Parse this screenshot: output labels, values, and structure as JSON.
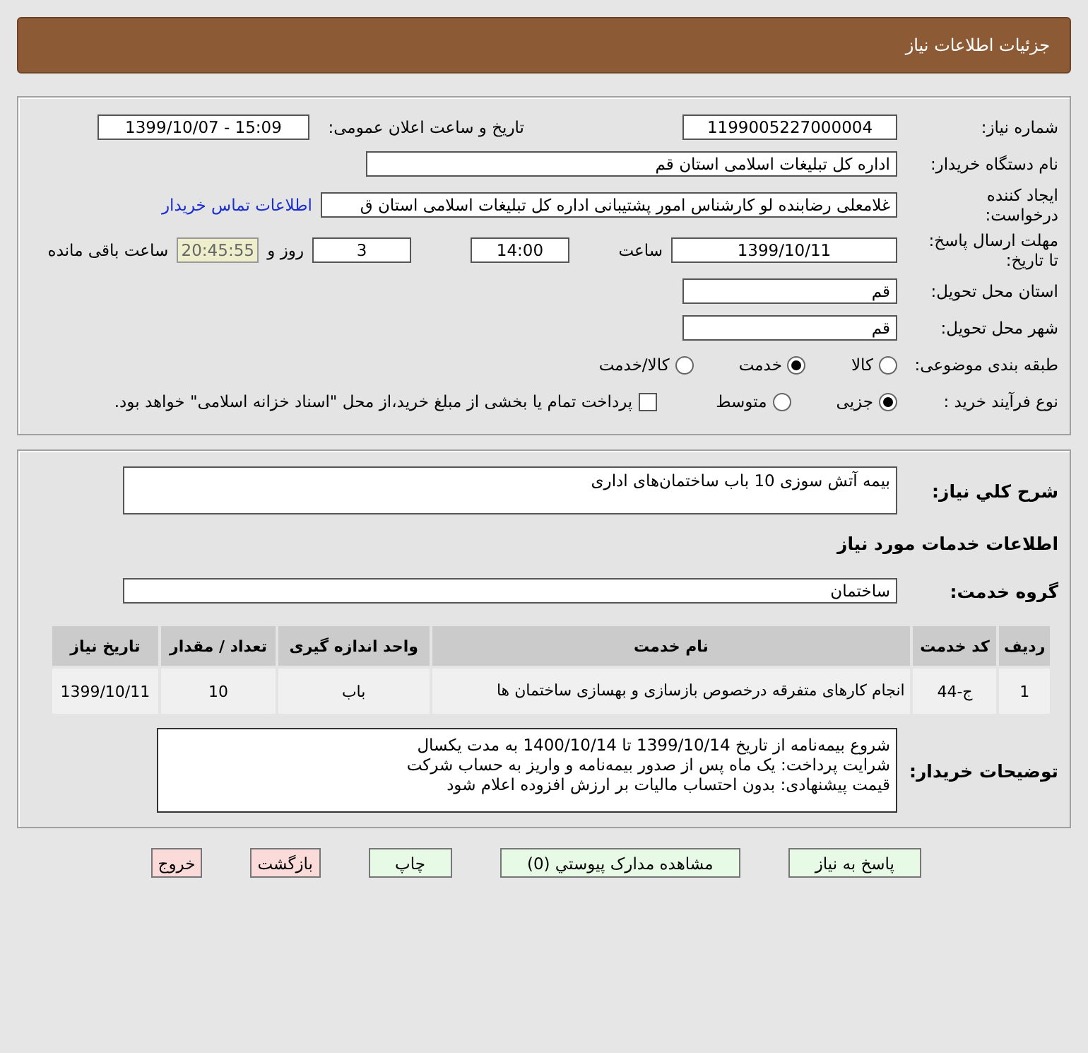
{
  "header": {
    "title": "جزئیات اطلاعات نیاز"
  },
  "need_number": {
    "label": "شماره نیاز:",
    "value": "1199005227000004"
  },
  "announce": {
    "label": "تاریخ و ساعت اعلان عمومی:",
    "value": "1399/10/07 - 15:09"
  },
  "buyer": {
    "label": "نام دستگاه خریدار:",
    "value": "اداره کل تبلیغات اسلامی استان قم"
  },
  "requester": {
    "label": "ایجاد کننده درخواست:",
    "value": "غلامعلی رضابنده لو کارشناس امور پشتیبانی اداره کل تبلیغات اسلامی استان ق",
    "link": "اطلاعات تماس خریدار"
  },
  "deadline": {
    "label": "مهلت ارسال پاسخ: تا تاریخ:",
    "date": "1399/10/11",
    "time_label": "ساعت",
    "time": "14:00",
    "days": "3",
    "days_label": "روز و",
    "remaining": "20:45:55",
    "remaining_label": "ساعت باقی مانده"
  },
  "province": {
    "label": "استان محل تحویل:",
    "value": "قم"
  },
  "city": {
    "label": "شهر محل تحویل:",
    "value": "قم"
  },
  "category": {
    "label": "طبقه بندی موضوعی:",
    "options": [
      {
        "label": "کالا",
        "selected": false
      },
      {
        "label": "خدمت",
        "selected": true
      },
      {
        "label": "کالا/خدمت",
        "selected": false
      }
    ]
  },
  "process": {
    "label": "نوع فرآیند خرید :",
    "options": [
      {
        "label": "جزیی",
        "selected": true
      },
      {
        "label": "متوسط",
        "selected": false
      }
    ],
    "payment": {
      "label": "پرداخت تمام یا بخشی از مبلغ خرید،از محل \"اسناد خزانه اسلامی\" خواهد بود.",
      "checked": false
    }
  },
  "summary": {
    "label": "شرح کلي نياز:",
    "value": "بیمه آتش سوزی 10 باب ساختمان‌های اداری"
  },
  "services_title": "اطلاعات خدمات مورد نياز",
  "service_group": {
    "label": "گروه خدمت:",
    "value": "ساختمان"
  },
  "table": {
    "columns": [
      "ردیف",
      "کد خدمت",
      "نام خدمت",
      "واحد اندازه گیری",
      "تعداد / مقدار",
      "تاریخ نیاز"
    ],
    "rows": [
      [
        "1",
        "ج-44",
        "انجام کارهای متفرقه درخصوص بازسازی و بهسازی ساختمان ها",
        "باب",
        "10",
        "1399/10/11"
      ]
    ]
  },
  "buyer_notes": {
    "label": "توضیحات خریدار:",
    "lines": [
      "شروع بیمه‌نامه از تاریخ 1399/10/14 تا 1400/10/14 به مدت یکسال",
      "شرایت پرداخت: یک ماه پس از صدور بیمه‌نامه و واریز به حساب شرکت",
      "قیمت پیشنهادی: بدون احتساب مالیات بر ارزش افزوده اعلام شود"
    ]
  },
  "buttons": [
    {
      "label": "پاسخ به نیاز",
      "kind": "normal"
    },
    {
      "label": "مشاهده مدارک پیوستي (0)",
      "kind": "normal"
    },
    {
      "label": "چاپ",
      "kind": "normal"
    },
    {
      "label": "بازگشت",
      "kind": "danger"
    },
    {
      "label": "خروج",
      "kind": "danger"
    }
  ]
}
